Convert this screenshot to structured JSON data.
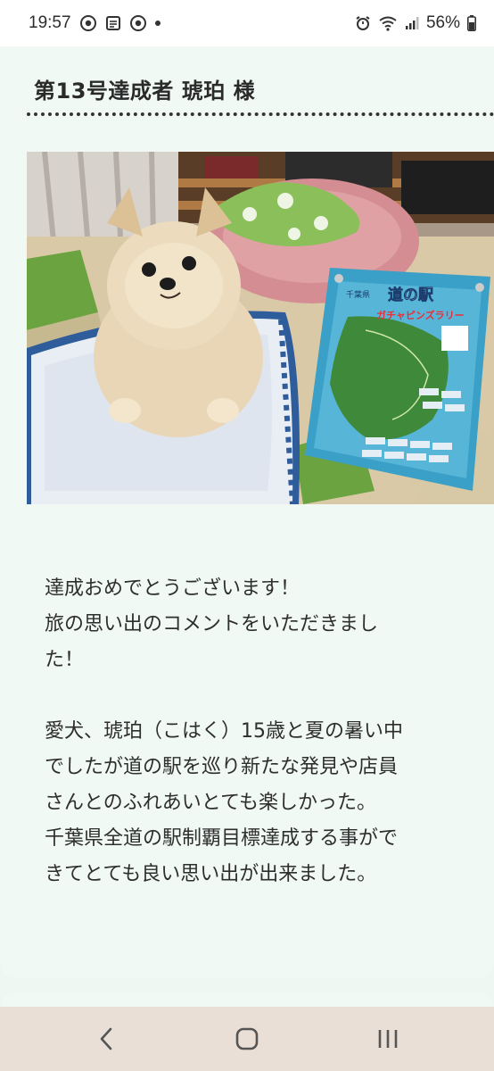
{
  "status_bar": {
    "time": "19:57",
    "battery": "56%",
    "icons_left": [
      "chrome-icon",
      "news-app-icon",
      "chrome-icon",
      "notification-dot"
    ],
    "icons_right": [
      "alarm-icon",
      "wifi-icon",
      "signal-icon",
      "battery-icon"
    ]
  },
  "article": {
    "title": "第13号達成者 琥珀 様",
    "photo_sign": {
      "prefecture": "千葉県",
      "heading": "道の駅",
      "subheading": "ガチャピンズラリー"
    },
    "message": {
      "para1_line1": "達成おめでとうございます！",
      "para1_line2": "旅の思い出のコメントをいただきまし",
      "para1_line3": "た！",
      "para2_line1": "愛犬、琥珀（こはく）15歳と夏の暑い中",
      "para2_line2": "でしたが道の駅を巡り新たな発見や店員",
      "para2_line3": "さんとのふれあいとても楽しかった。",
      "para2_line4": "千葉県全道の駅制覇目標達成する事がで",
      "para2_line5": "きてとても良い思い出が出来ました。"
    }
  },
  "nav": {
    "back": "back-icon",
    "home": "home-icon",
    "recents": "recents-icon"
  },
  "colors": {
    "page_bg": "#eef7f1",
    "nav_bg": "#eadfd6",
    "text": "#2b2b2b"
  }
}
